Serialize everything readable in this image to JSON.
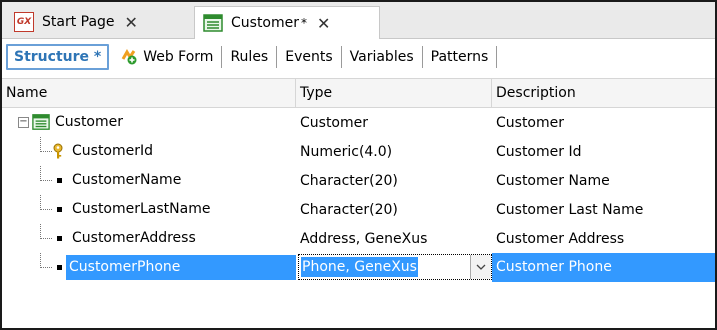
{
  "tabs": [
    {
      "icon": "gx-icon",
      "label": "Start Page"
    },
    {
      "icon": "transaction-icon",
      "label": "Customer",
      "modified": "*"
    }
  ],
  "subtabs": [
    "Structure *",
    "Web Form",
    "Rules",
    "Events",
    "Variables",
    "Patterns"
  ],
  "grid": {
    "columns": [
      "Name",
      "Type",
      "Description"
    ],
    "rows": [
      {
        "name": "Customer",
        "type": "Customer",
        "description": "Customer"
      },
      {
        "name": "CustomerId",
        "type": "Numeric(4.0)",
        "description": "Customer Id"
      },
      {
        "name": "CustomerName",
        "type": "Character(20)",
        "description": "Customer Name"
      },
      {
        "name": "CustomerLastName",
        "type": "Character(20)",
        "description": "Customer Last Name"
      },
      {
        "name": "CustomerAddress",
        "type": "Address, GeneXus",
        "description": "Customer Address"
      },
      {
        "name": "CustomerPhone",
        "type": "Phone, GeneXus",
        "description": "Customer Phone"
      }
    ]
  },
  "colors": {
    "accent": "#3399ff",
    "structure_tab": "#2e75b6",
    "gx_red": "#c0392b"
  }
}
